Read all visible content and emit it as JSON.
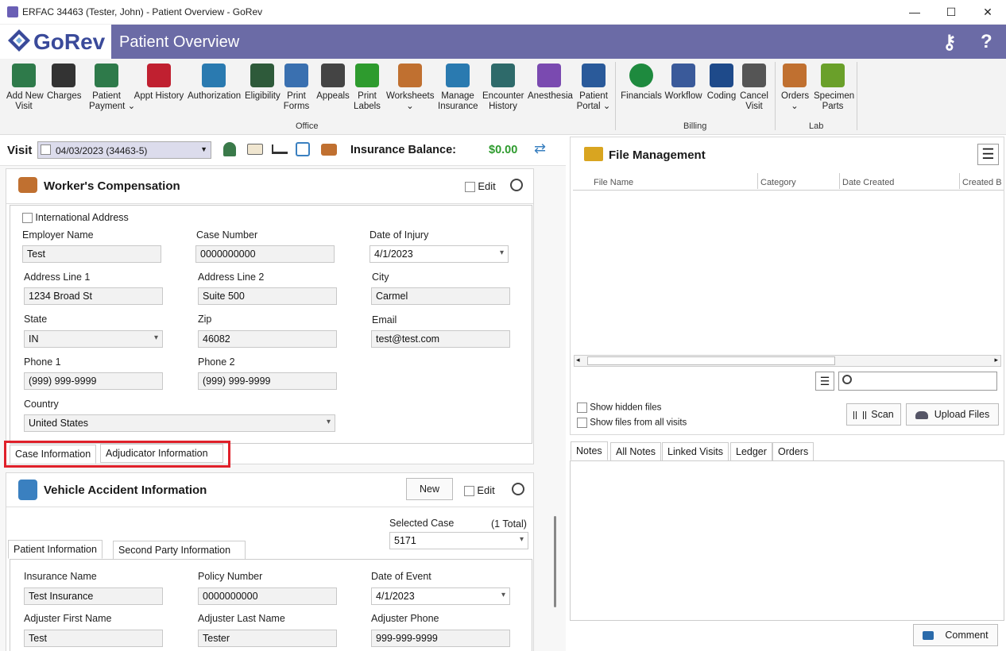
{
  "window": {
    "title": "ERFAC 34463 (Tester, John) - Patient Overview - GoRev"
  },
  "header": {
    "logo": "GoRev",
    "page_title": "Patient Overview"
  },
  "toolbar": {
    "items": [
      {
        "label": "Add New\nVisit",
        "icon": "bed-plus-icon"
      },
      {
        "label": "Charges",
        "icon": "barcode-icon"
      },
      {
        "label": "Patient\nPayment ⌄",
        "icon": "payment-icon"
      },
      {
        "label": "Appt History",
        "icon": "calendar-icon"
      },
      {
        "label": "Authorization",
        "icon": "shield-check-icon"
      },
      {
        "label": "Eligibility",
        "icon": "person-check-icon"
      },
      {
        "label": "Print\nForms",
        "icon": "printer-icon"
      },
      {
        "label": "Appeals",
        "icon": "briefcase-icon"
      },
      {
        "label": "Print\nLabels",
        "icon": "tag-icon"
      },
      {
        "label": "Worksheets\n⌄",
        "icon": "worksheets-icon"
      },
      {
        "label": "Manage\nInsurance",
        "icon": "insurance-shield-icon"
      },
      {
        "label": "Encounter\nHistory",
        "icon": "encounter-calendar-icon"
      },
      {
        "label": "Anesthesia",
        "icon": "syringe-icon"
      },
      {
        "label": "Patient\nPortal ⌄",
        "icon": "globe-gear-icon"
      },
      {
        "label": "Financials",
        "icon": "dollar-icon"
      },
      {
        "label": "Workflow",
        "icon": "workflow-icon"
      },
      {
        "label": "Coding",
        "icon": "coding-book-icon"
      },
      {
        "label": "Cancel\nVisit",
        "icon": "cancel-clock-icon"
      },
      {
        "label": "Orders\n⌄",
        "icon": "orders-icon"
      },
      {
        "label": "Specimen\nParts",
        "icon": "specimen-icon"
      }
    ],
    "groups": {
      "office": "Office",
      "billing": "Billing",
      "lab": "Lab"
    }
  },
  "visit": {
    "label": "Visit",
    "selected": "04/03/2023 (34463-5)",
    "insurance_balance_label": "Insurance Balance:",
    "insurance_balance": "$0.00"
  },
  "workers_comp": {
    "title": "Worker's Compensation",
    "edit_label": "Edit",
    "intl_label": "International Address",
    "employer_name_label": "Employer Name",
    "employer_name": "Test",
    "case_number_label": "Case Number",
    "case_number": "0000000000",
    "date_of_injury_label": "Date of Injury",
    "date_of_injury": "4/1/2023",
    "address1_label": "Address Line 1",
    "address1": "1234 Broad St",
    "address2_label": "Address Line 2",
    "address2": "Suite 500",
    "city_label": "City",
    "city": "Carmel",
    "state_label": "State",
    "state": "IN",
    "zip_label": "Zip",
    "zip": "46082",
    "email_label": "Email",
    "email": "test@test.com",
    "phone1_label": "Phone 1",
    "phone1": "(999) 999-9999",
    "phone2_label": "Phone 2",
    "phone2": "(999) 999-9999",
    "country_label": "Country",
    "country": "United States",
    "tabs": [
      "Case Information",
      "Adjudicator Information"
    ]
  },
  "vehicle": {
    "title": "Vehicle Accident Information",
    "new_label": "New",
    "edit_label": "Edit",
    "selected_case_label": "Selected Case",
    "total": "(1 Total)",
    "selected_case": "5171",
    "tabs": [
      "Patient Information",
      "Second Party Information"
    ],
    "insurance_name_label": "Insurance Name",
    "insurance_name": "Test Insurance",
    "policy_number_label": "Policy Number",
    "policy_number": "0000000000",
    "date_of_event_label": "Date of Event",
    "date_of_event": "4/1/2023",
    "adj_first_label": "Adjuster First Name",
    "adj_first": "Test",
    "adj_last_label": "Adjuster Last Name",
    "adj_last": "Tester",
    "adj_phone_label": "Adjuster Phone",
    "adj_phone": "999-999-9999"
  },
  "files": {
    "title": "File Management",
    "columns": [
      "File Name",
      "Category",
      "Date Created",
      "Created B"
    ],
    "show_hidden": "Show hidden files",
    "show_all": "Show files from all visits",
    "scan_label": "Scan",
    "upload_label": "Upload Files"
  },
  "notes": {
    "tabs": [
      "Notes",
      "All Notes",
      "Linked Visits",
      "Ledger",
      "Orders"
    ],
    "comment_label": "Comment"
  },
  "colors": {
    "header": "#6b6ba6",
    "accent_green": "#2e9b2e",
    "highlight": "#e0202a"
  }
}
